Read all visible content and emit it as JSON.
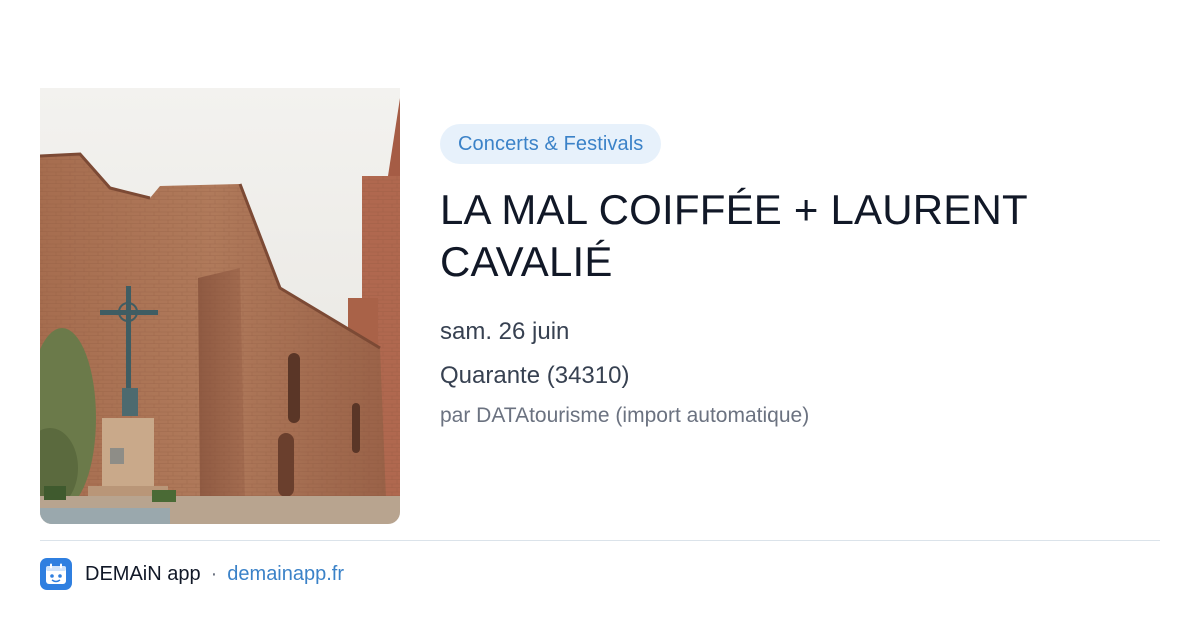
{
  "event": {
    "category": "Concerts & Festivals",
    "title": "LA MAL COIFFÉE + LAURENT CAVALIÉ",
    "date": "sam. 26 juin",
    "location": "Quarante (34310)",
    "source": "par DATAtourisme (import automatique)"
  },
  "footer": {
    "app_name": "DEMAiN app",
    "separator": "·",
    "link": "demainapp.fr"
  },
  "image": {
    "subject": "stone church with cross monument"
  },
  "colors": {
    "accent": "#3b82c8",
    "badge_bg": "#e7f1fb",
    "logo_bg": "#2f7fe0"
  }
}
